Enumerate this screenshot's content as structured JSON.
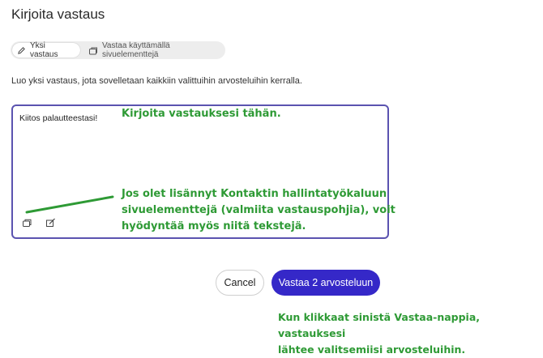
{
  "page": {
    "title": "Kirjoita vastaus"
  },
  "mode_toggle": {
    "options": [
      {
        "label": "Yksi vastaus",
        "icon": "pencil-icon",
        "selected": true
      },
      {
        "label": "Vastaa käyttämällä sivuelementtejä",
        "icon": "snippet-icon",
        "selected": false
      }
    ]
  },
  "description": "Luo yksi vastaus, jota sovelletaan kaikkiin valittuihin arvosteluihin kerralla.",
  "response": {
    "text": "Kiitos palautteestasi!"
  },
  "box_icons": [
    "snippet-icon",
    "edit-icon"
  ],
  "annotations": {
    "write_here": "Kirjoita vastauksesi tähän.",
    "snippets": [
      "Jos olet lisännyt Kontaktin hallintatyökaluun",
      "sivuelementtejä (valmiita vastauspohjia), voit",
      "hyödyntää myös niitä tekstejä."
    ],
    "submit": [
      "Kun klikkaat sinistä Vastaa-nappia, vastauksesi",
      "lähtee valitsemiisi arvosteluihin."
    ]
  },
  "buttons": {
    "cancel": "Cancel",
    "submit": "Vastaa 2 arvosteluun"
  },
  "colors": {
    "accent": "#3528c8",
    "box_border": "#5b53b0",
    "annotation": "#2e9a35"
  }
}
